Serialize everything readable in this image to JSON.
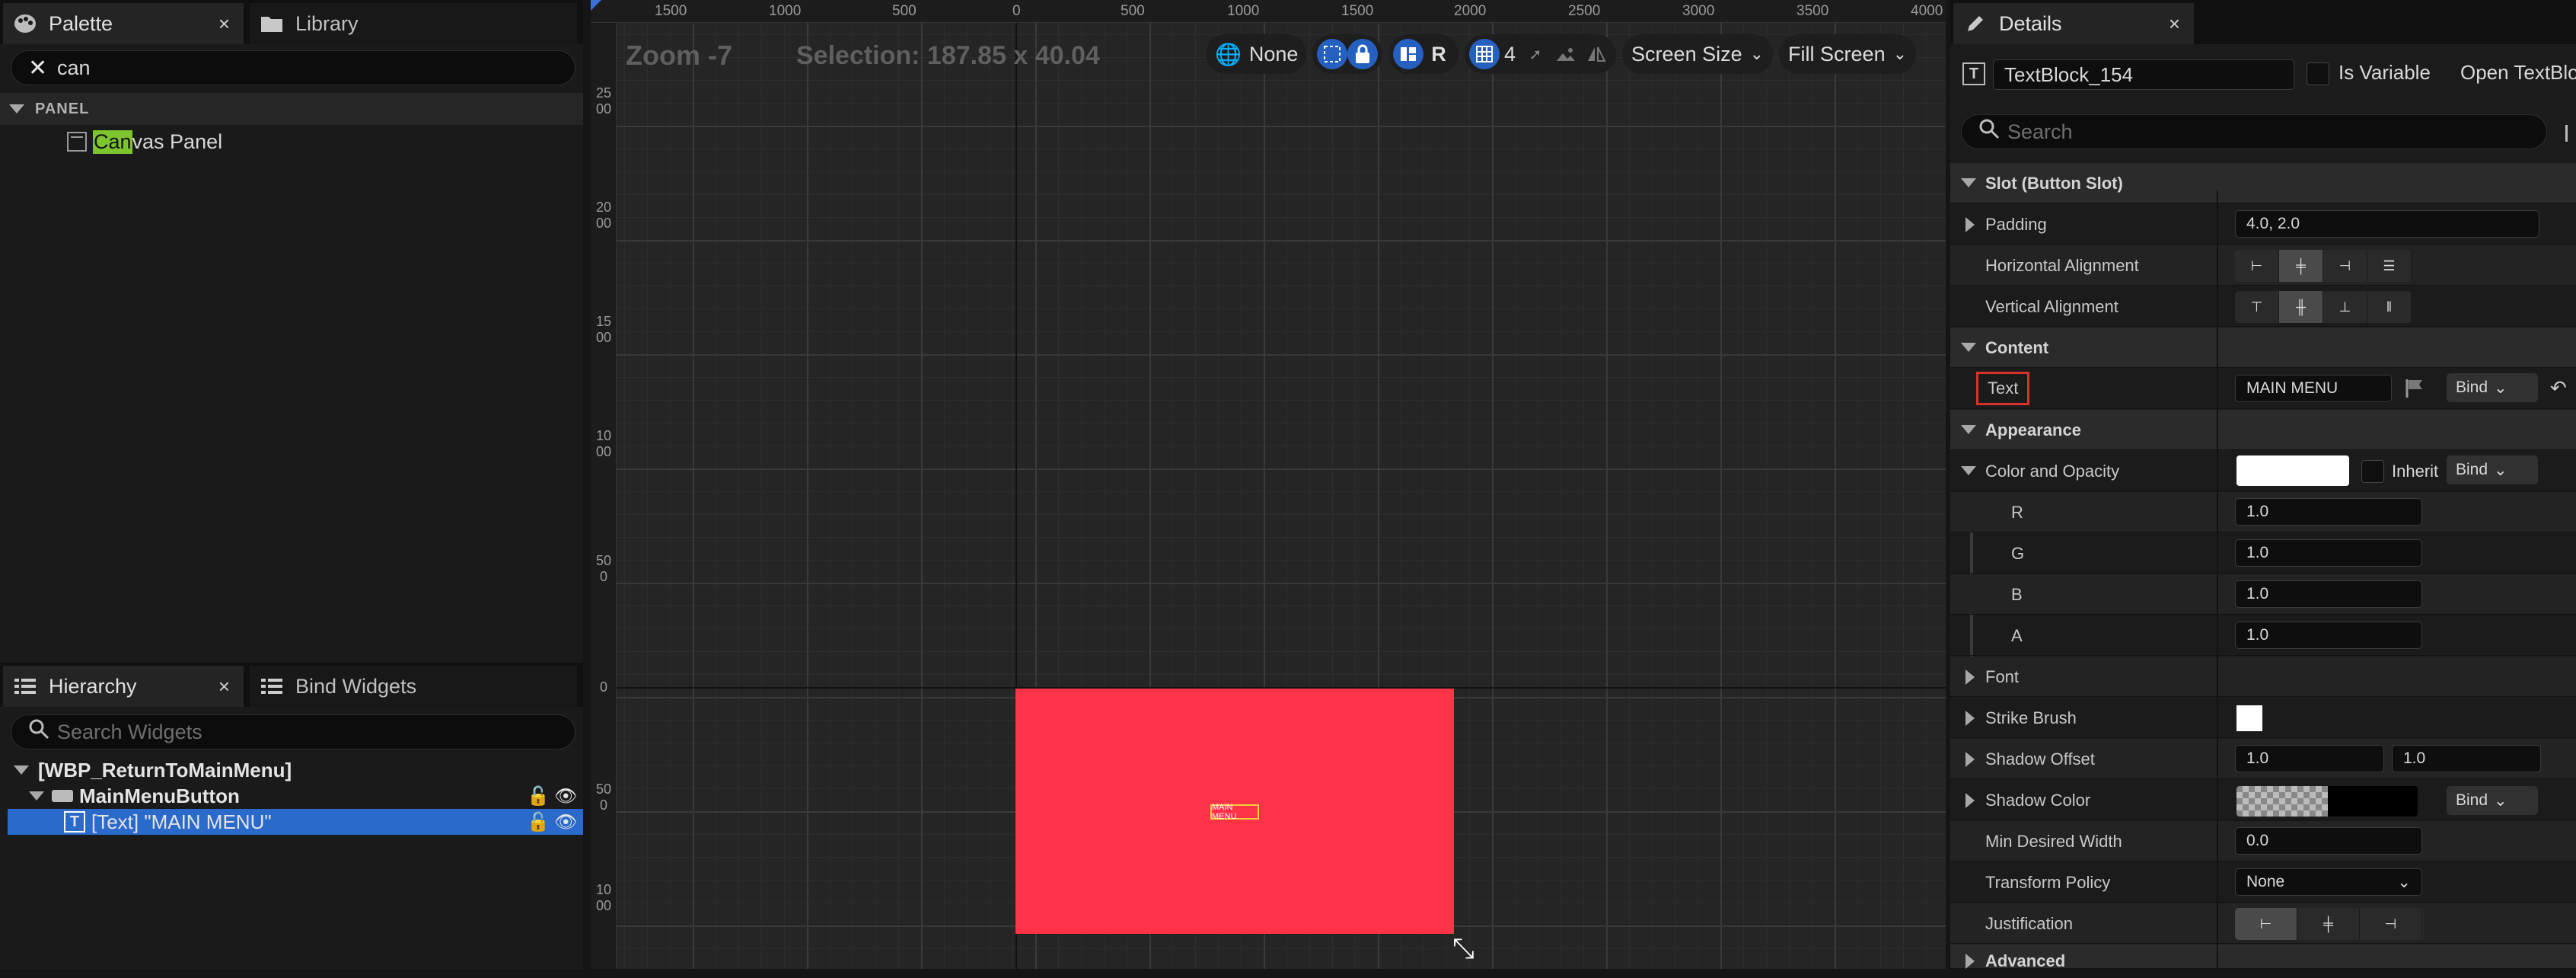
{
  "palette": {
    "tab_label": "Palette",
    "library_label": "Library",
    "close": "×",
    "search_value": "can",
    "section": "PANEL",
    "item_match": "Can",
    "item_rest": "vas Panel"
  },
  "hierarchy": {
    "tab_label": "Hierarchy",
    "bind_tab_label": "Bind Widgets",
    "close": "×",
    "search_placeholder": "Search Widgets",
    "rows": [
      "[WBP_ReturnToMainMenu]",
      "MainMenuButton",
      "[Text] \"MAIN MENU\""
    ]
  },
  "viewport": {
    "zoom": "Zoom -7",
    "selection": "Selection: 187.85 x 40.04",
    "ruler_top": [
      "1500",
      "1000",
      "500",
      "0",
      "500",
      "1000",
      "1500",
      "2000",
      "2500",
      "3000",
      "3500",
      "4000"
    ],
    "ruler_left": [
      "2500",
      "2000",
      "1500",
      "1000",
      "500",
      "0",
      "500",
      "1000"
    ],
    "toolbar": {
      "localize": "None",
      "r_label": "R",
      "grid_value": "4",
      "screen_size": "Screen Size",
      "fill_screen": "Fill Screen"
    },
    "widget_text": "MAIN MENU",
    "widget_color": "#ff3347"
  },
  "details": {
    "tab_label": "Details",
    "close": "×",
    "name_value": "TextBlock_154",
    "is_variable": "Is Variable",
    "open_text": "Open TextBlo",
    "search_placeholder": "Search",
    "sections": {
      "slot": "Slot (Button Slot)",
      "content": "Content",
      "appearance": "Appearance",
      "advanced": "Advanced"
    },
    "rows": {
      "padding_label": "Padding",
      "padding_value": "4.0, 2.0",
      "halign_label": "Horizontal Alignment",
      "valign_label": "Vertical Alignment",
      "text_label": "Text",
      "text_value": "MAIN MENU",
      "bind": "Bind",
      "color_label": "Color and Opacity",
      "inherit": "Inherit",
      "r_label": "R",
      "r_value": "1.0",
      "g_label": "G",
      "g_value": "1.0",
      "b_label": "B",
      "b_value": "1.0",
      "a_label": "A",
      "a_value": "1.0",
      "font_label": "Font",
      "strike_label": "Strike Brush",
      "shadow_offset_label": "Shadow Offset",
      "shadow_offset_x": "1.0",
      "shadow_offset_y": "1.0",
      "shadow_color_label": "Shadow Color",
      "min_width_label": "Min Desired Width",
      "min_width_value": "0.0",
      "transform_label": "Transform Policy",
      "transform_value": "None",
      "justification_label": "Justification"
    },
    "highlight_color": "#d8332b"
  }
}
